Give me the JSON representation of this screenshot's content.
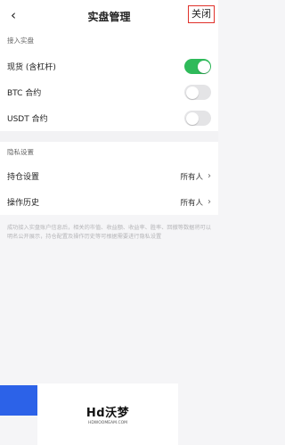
{
  "header": {
    "back_icon": "‹",
    "title": "实盘管理",
    "close_label": "关闭"
  },
  "section1": {
    "label": "接入实盘",
    "items": [
      {
        "label": "现货 (含杠杆)",
        "enabled": true
      },
      {
        "label": "BTC 合约",
        "enabled": false
      },
      {
        "label": "USDT 合约",
        "enabled": false
      }
    ]
  },
  "section2": {
    "label": "隐私设置",
    "items": [
      {
        "label": "持仓设置",
        "value": "所有人"
      },
      {
        "label": "操作历史",
        "value": "所有人"
      }
    ]
  },
  "note": "成功接入实盘账户信息后，相关的市值、收益额、收益率、胜率、回撤等数据将可以明名公开展示，持仓配置及操作历史等可根据需要进行隐私设置",
  "watermark": {
    "main": "Hd沃梦",
    "sub": "HDWOOMEAM.COM"
  },
  "colors": {
    "toggle_on": "#2fba5a",
    "toggle_off": "#e4e4e6",
    "accent": "#2c62e8",
    "close_border": "#e0312a"
  }
}
